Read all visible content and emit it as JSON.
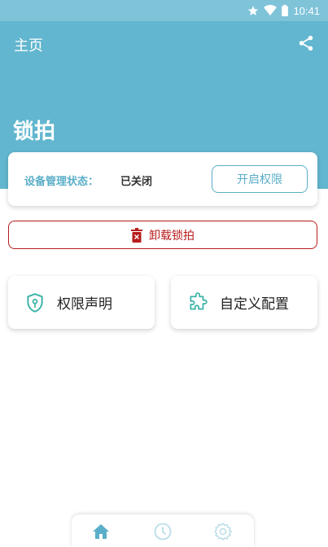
{
  "status_bar": {
    "time": "10:41",
    "icons": [
      "star-icon",
      "wifi-icon",
      "battery-icon"
    ]
  },
  "header": {
    "title": "主页",
    "share_icon": "share-icon"
  },
  "app_name": "锁拍",
  "status_card": {
    "label": "设备管理状态：",
    "value": "已关闭",
    "button": "开启权限"
  },
  "uninstall": {
    "label": "卸载锁拍",
    "icon": "trash-icon"
  },
  "tiles": [
    {
      "label": "权限声明",
      "icon": "shield-lock-icon"
    },
    {
      "label": "自定义配置",
      "icon": "puzzle-icon"
    }
  ],
  "bottom_nav": [
    {
      "icon": "home-icon",
      "active": true
    },
    {
      "icon": "clock-icon",
      "active": false
    },
    {
      "icon": "gear-icon",
      "active": false
    }
  ],
  "colors": {
    "accent": "#62b6cf",
    "status_bar": "#7fc3d9",
    "danger": "#b71c1c",
    "tile_icon": "#3bb3a8",
    "nav_active": "#5aaec8",
    "nav_inactive": "#b9dde8"
  }
}
